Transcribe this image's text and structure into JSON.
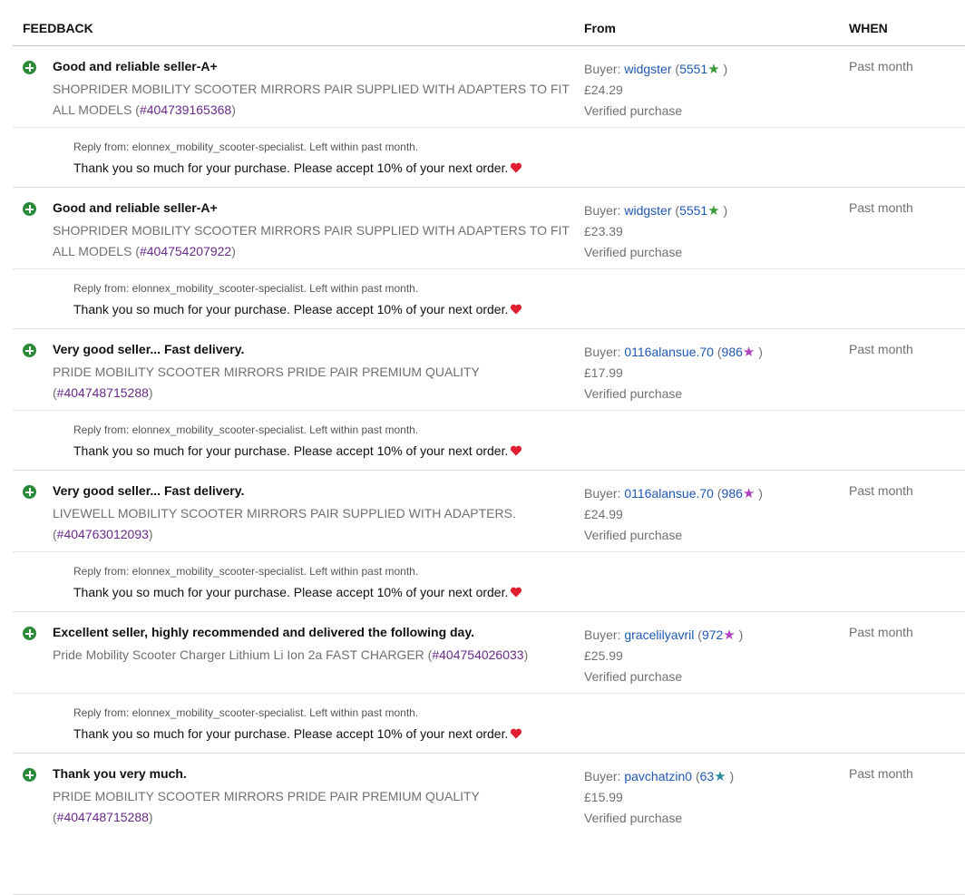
{
  "header": {
    "feedback": "FEEDBACK",
    "from": "From",
    "when": "WHEN"
  },
  "entries": [
    {
      "comment": "Good and reliable seller-A+",
      "item_title": "SHOPRIDER MOBILITY SCOOTER MIRRORS PAIR SUPPLIED WITH ADAPTERS TO FIT ALL MODELS",
      "item_number": "#404739165368",
      "buyer_prefix": "Buyer: ",
      "buyer_name": "widgster",
      "buyer_score": "5551",
      "star_color": "#3a9a3a",
      "price": "£24.29",
      "verified": "Verified purchase",
      "when": "Past month",
      "reply_meta": "Reply from: elonnex_mobility_scooter-specialist. Left within past month.",
      "reply_text": "Thank you so much for your purchase. Please accept 10% of your next order."
    },
    {
      "comment": "Good and reliable seller-A+",
      "item_title": "SHOPRIDER MOBILITY SCOOTER MIRRORS PAIR SUPPLIED WITH ADAPTERS TO FIT ALL MODELS",
      "item_number": "#404754207922",
      "buyer_prefix": "Buyer: ",
      "buyer_name": "widgster",
      "buyer_score": "5551",
      "star_color": "#3a9a3a",
      "price": "£23.39",
      "verified": "Verified purchase",
      "when": "Past month",
      "reply_meta": "Reply from: elonnex_mobility_scooter-specialist. Left within past month.",
      "reply_text": "Thank you so much for your purchase. Please accept 10% of your next order."
    },
    {
      "comment": "Very good seller... Fast delivery.",
      "item_title": "PRIDE MOBILITY SCOOTER MIRRORS PRIDE PAIR PREMIUM QUALITY",
      "item_number": "#404748715288",
      "buyer_prefix": "Buyer: ",
      "buyer_name": "0116alansue.70",
      "buyer_score": "986",
      "star_color": "#b040c0",
      "price": "£17.99",
      "verified": "Verified purchase",
      "when": "Past month",
      "reply_meta": "Reply from: elonnex_mobility_scooter-specialist. Left within past month.",
      "reply_text": "Thank you so much for your purchase. Please accept 10% of your next order."
    },
    {
      "comment": "Very good seller... Fast delivery.",
      "item_title": "LIVEWELL MOBILITY SCOOTER MIRRORS PAIR SUPPLIED WITH ADAPTERS.",
      "item_number": "#404763012093",
      "buyer_prefix": "Buyer: ",
      "buyer_name": "0116alansue.70",
      "buyer_score": "986",
      "star_color": "#b040c0",
      "price": "£24.99",
      "verified": "Verified purchase",
      "when": "Past month",
      "reply_meta": "Reply from: elonnex_mobility_scooter-specialist. Left within past month.",
      "reply_text": "Thank you so much for your purchase. Please accept 10% of your next order."
    },
    {
      "comment": "Excellent seller, highly recommended and delivered the following day.",
      "item_title": "Pride Mobility Scooter Charger Lithium Li Ion 2a FAST CHARGER",
      "item_number": "#404754026033",
      "buyer_prefix": "Buyer: ",
      "buyer_name": "gracelilyavril",
      "buyer_score": "972",
      "star_color": "#b040c0",
      "price": "£25.99",
      "verified": "Verified purchase",
      "when": "Past month",
      "reply_meta": "Reply from: elonnex_mobility_scooter-specialist. Left within past month.",
      "reply_text": "Thank you so much for your purchase. Please accept 10% of your next order."
    },
    {
      "comment": "Thank you very much.",
      "item_title": "PRIDE MOBILITY SCOOTER MIRRORS PRIDE PAIR PREMIUM QUALITY",
      "item_number": "#404748715288",
      "buyer_prefix": "Buyer: ",
      "buyer_name": "pavchatzin0",
      "buyer_score": "63",
      "star_color": "#2a8aa0",
      "price": "£15.99",
      "verified": "Verified purchase",
      "when": "Past month",
      "reply_meta": "",
      "reply_text": ""
    }
  ],
  "icons": {
    "positive": "plus-circle-icon",
    "rating": "star-icon",
    "heart": "heart-icon"
  },
  "colors": {
    "positive": "#2a8a3a",
    "link": "#1f57b3",
    "item_number": "#6a2a8a",
    "heart": "#e02030"
  }
}
